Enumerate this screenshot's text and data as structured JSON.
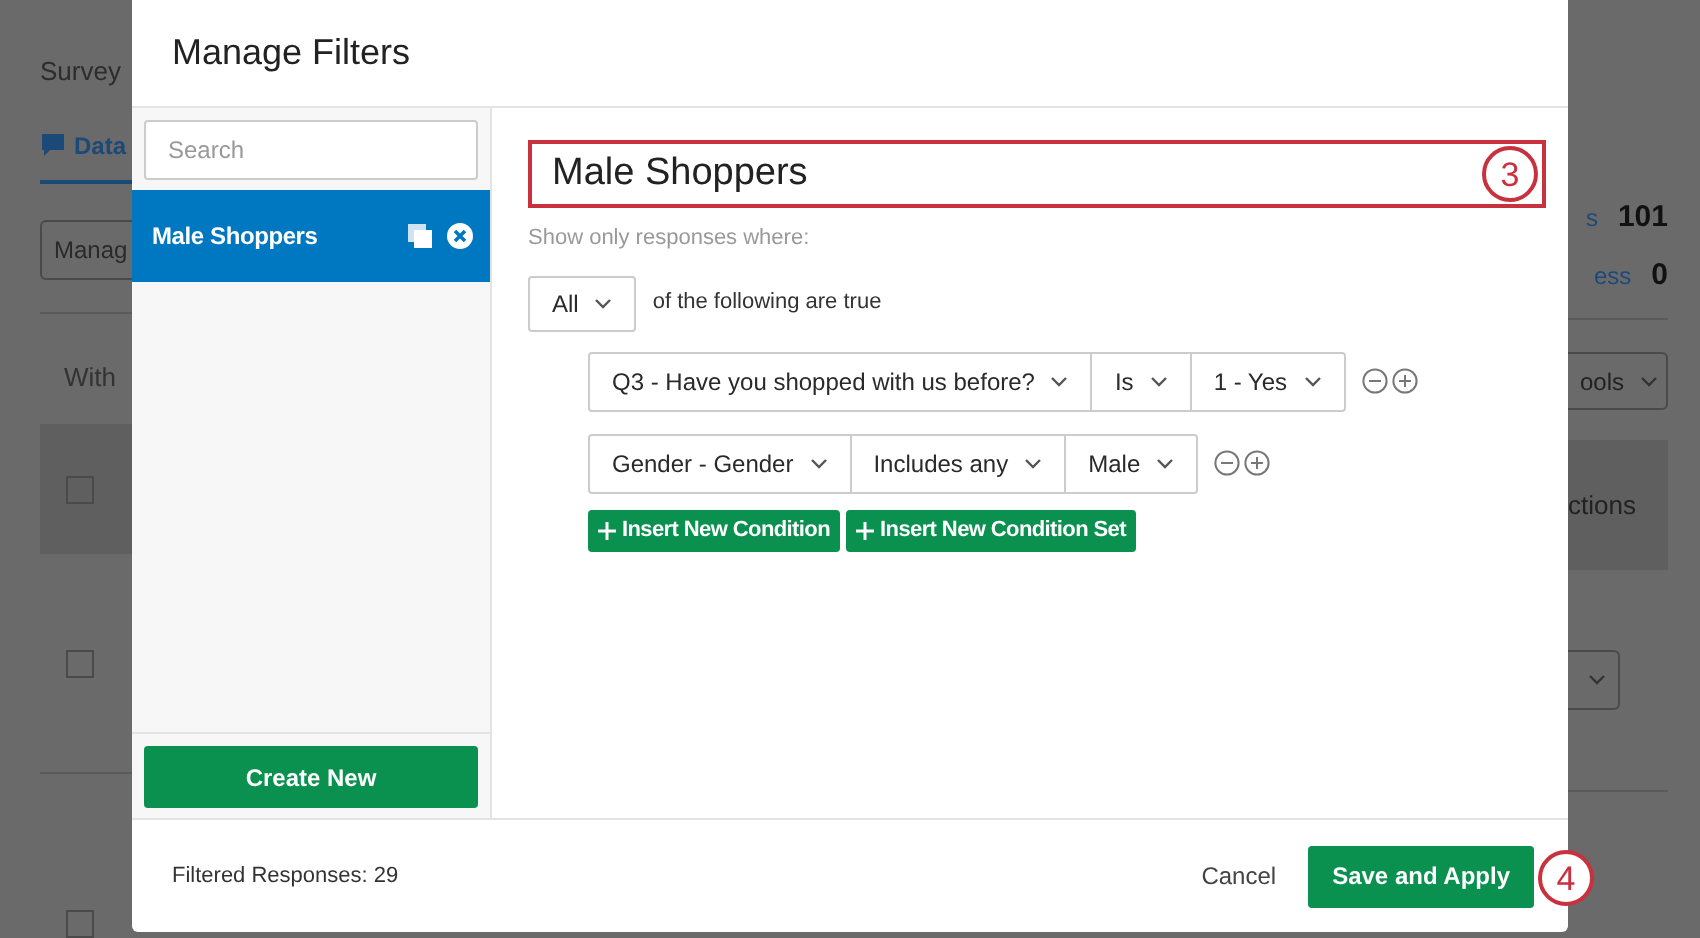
{
  "background": {
    "nav_label": "Survey",
    "tab": {
      "label": "Data",
      "selected": true
    },
    "button": "Manag",
    "subtitle": "With",
    "checkboxes": [
      {
        "checked": false
      },
      {
        "checked": false
      },
      {
        "checked": false
      }
    ],
    "stats": [
      {
        "label": "s",
        "value": "101"
      },
      {
        "label": "ess",
        "value": "0"
      }
    ],
    "dropdown": "ools",
    "column_header": "ctions"
  },
  "dialog": {
    "title": "Manage Filters",
    "search": {
      "placeholder": "Search"
    },
    "filters": [
      {
        "name": "Male Shoppers",
        "selected": true
      }
    ],
    "create_button": "Create New",
    "filter_name": "Male Shoppers",
    "hint": "Show only responses where:",
    "match": {
      "value": "All",
      "suffix": "of the following are true"
    },
    "conditions": [
      {
        "field": "Q3 - Have you shopped with us before?",
        "operator": "Is",
        "value": "1 - Yes"
      },
      {
        "field": "Gender - Gender",
        "operator": "Includes any",
        "value": "Male"
      }
    ],
    "actions": [
      "Insert New Condition",
      "Insert New Condition Set"
    ],
    "footer": {
      "count": "Filtered Responses: 29",
      "cancel": "Cancel",
      "save": "Save and Apply"
    }
  },
  "callouts": [
    "3",
    "4"
  ]
}
